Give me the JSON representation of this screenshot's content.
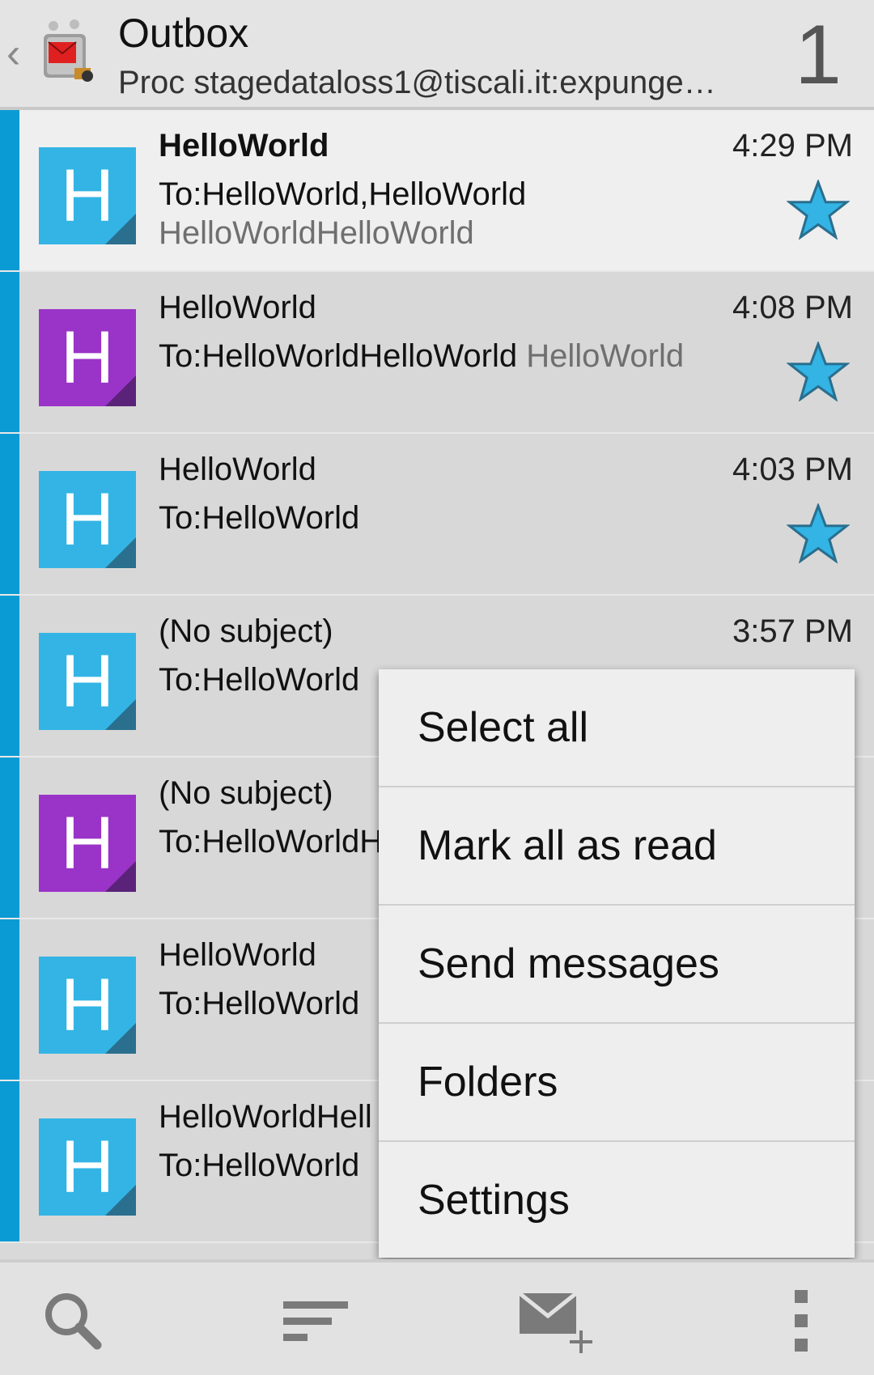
{
  "actionbar": {
    "title": "Outbox",
    "subtitle": "Proc stagedataloss1@tiscali.it:expunge…",
    "count": "1"
  },
  "messages": [
    {
      "subject": "HelloWorld",
      "to": "To:HelloWorld,HelloWorld",
      "preview": "HelloWorldHelloWorld",
      "time": "4:29 PM",
      "avatar": "H",
      "avatar_color": "#33b4e5",
      "starred": true,
      "unread": true
    },
    {
      "subject": "HelloWorld",
      "to": "To:HelloWorldHelloWorld",
      "preview": "HelloWorld",
      "time": "4:08 PM",
      "avatar": "H",
      "avatar_color": "#9a33c8",
      "starred": true,
      "unread": false
    },
    {
      "subject": "HelloWorld",
      "to": "To:HelloWorld",
      "preview": "",
      "time": "4:03 PM",
      "avatar": "H",
      "avatar_color": "#33b4e5",
      "starred": true,
      "unread": false
    },
    {
      "subject": "(No subject)",
      "to": "To:HelloWorld",
      "preview": "",
      "time": "3:57 PM",
      "avatar": "H",
      "avatar_color": "#33b4e5",
      "starred": false,
      "unread": false
    },
    {
      "subject": "(No subject)",
      "to": "To:HelloWorldH",
      "preview": "",
      "time": "",
      "avatar": "H",
      "avatar_color": "#9a33c8",
      "starred": false,
      "unread": false
    },
    {
      "subject": "HelloWorld",
      "to": "To:HelloWorld",
      "preview": "",
      "time": "",
      "avatar": "H",
      "avatar_color": "#33b4e5",
      "starred": false,
      "unread": false
    },
    {
      "subject": "HelloWorldHell",
      "to": "To:HelloWorld",
      "preview": "",
      "time": "",
      "avatar": "H",
      "avatar_color": "#33b4e5",
      "starred": false,
      "unread": false
    }
  ],
  "menu": {
    "items": [
      "Select all",
      "Mark all as read",
      "Send messages",
      "Folders",
      "Settings"
    ]
  },
  "bottombar": {
    "icons": [
      "search-icon",
      "sort-icon",
      "compose-icon",
      "overflow-icon"
    ]
  },
  "colors": {
    "accent": "#0b9bd4",
    "star": "#33b4e5",
    "avatar_blue": "#33b4e5",
    "avatar_purple": "#9a33c8"
  }
}
